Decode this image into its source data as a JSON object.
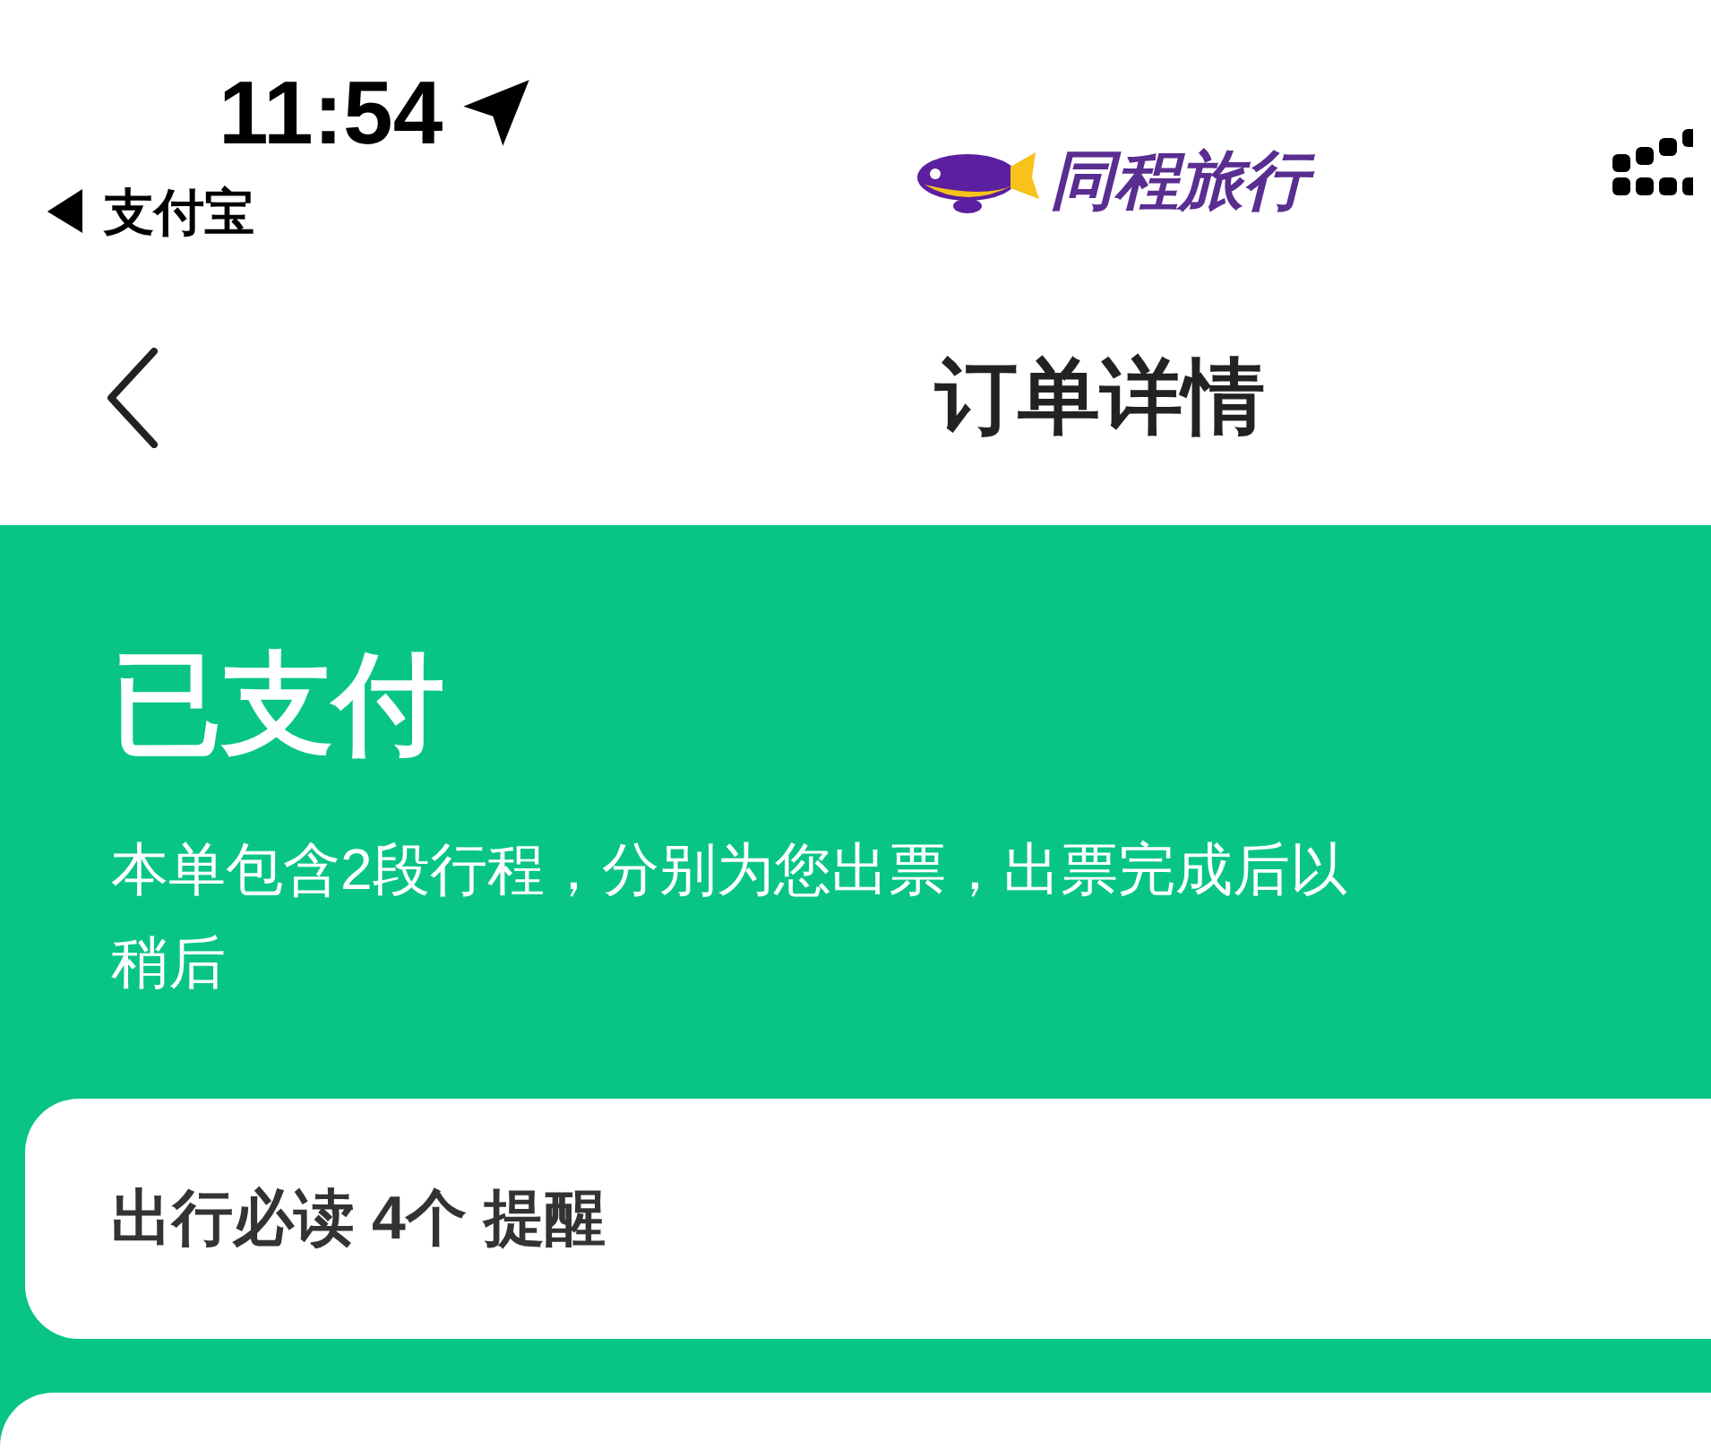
{
  "status_bar": {
    "time": "11:54",
    "back_app": "◀ 支付宝",
    "brand": "同程旅行"
  },
  "nav": {
    "title": "订单详情"
  },
  "status": {
    "title": "已支付",
    "message_lines": [
      "本单包含2段行程，分别为您出票，出票完成后以",
      "稍后"
    ]
  },
  "notice_card": {
    "label": "出行必读 4个 提醒"
  }
}
